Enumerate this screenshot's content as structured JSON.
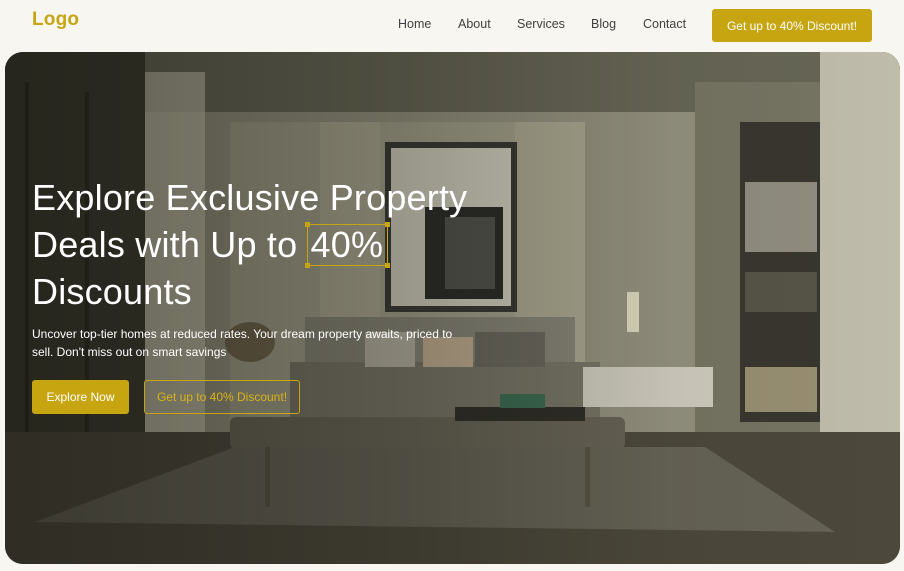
{
  "header": {
    "logo": "Logo",
    "nav": [
      "Home",
      "About",
      "Services",
      "Blog",
      "Contact"
    ],
    "cta": "Get up to 40% Discount!"
  },
  "hero": {
    "title_line1": "Explore Exclusive Property",
    "title_line2_prefix": "Deals with Up to",
    "title_highlight": "40%",
    "title_line3": "Discounts",
    "subtitle": "Uncover top-tier homes at reduced rates. Your dream property awaits, priced to sell. Don't miss out on smart savings",
    "primary_button": "Explore Now",
    "secondary_button": "Get up to 40% Discount!",
    "background_image": "modern bedroom interior"
  },
  "colors": {
    "accent": "#c6a511",
    "background": "#f7f6f0",
    "nav_text": "#3f3f3f"
  }
}
